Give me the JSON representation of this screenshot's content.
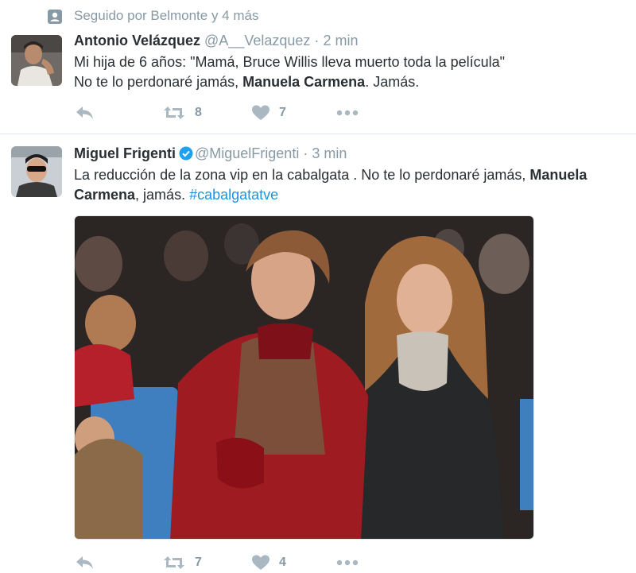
{
  "context": {
    "text": "Seguido por Belmonte y 4 más",
    "icon": "person-icon"
  },
  "tweets": [
    {
      "name": "Antonio Velázquez",
      "handle": "@A__Velazquez",
      "separator": "·",
      "time": "2 min",
      "verified": false,
      "text": {
        "line1": "Mi hija de 6 años: \"Mamá, Bruce Willis lleva muerto toda la película\"",
        "line2_pre": "No te lo perdonaré jamás, ",
        "line2_bold": "Manuela Carmena",
        "line2_post": ". Jamás."
      },
      "actions": {
        "reply_icon": "reply-icon",
        "retweet_count": "8",
        "like_count": "7",
        "more_icon": "more-icon"
      }
    },
    {
      "name": "Miguel Frigenti",
      "handle": "@MiguelFrigenti",
      "separator": "·",
      "time": "3 min",
      "verified": true,
      "text": {
        "part1": "La reducción de la zona vip en la cabalgata . No te lo perdonaré jamás, ",
        "bold": "Manuela Carmena",
        "part2": ", jamás. ",
        "hashtag": "#cabalgatatve"
      },
      "actions": {
        "reply_icon": "reply-icon",
        "retweet_count": "7",
        "like_count": "4",
        "more_icon": "more-icon"
      }
    }
  ],
  "colors": {
    "muted": "#8899a6",
    "text": "#292f33",
    "link": "#1b95e0",
    "divider": "#e1e8ed"
  }
}
